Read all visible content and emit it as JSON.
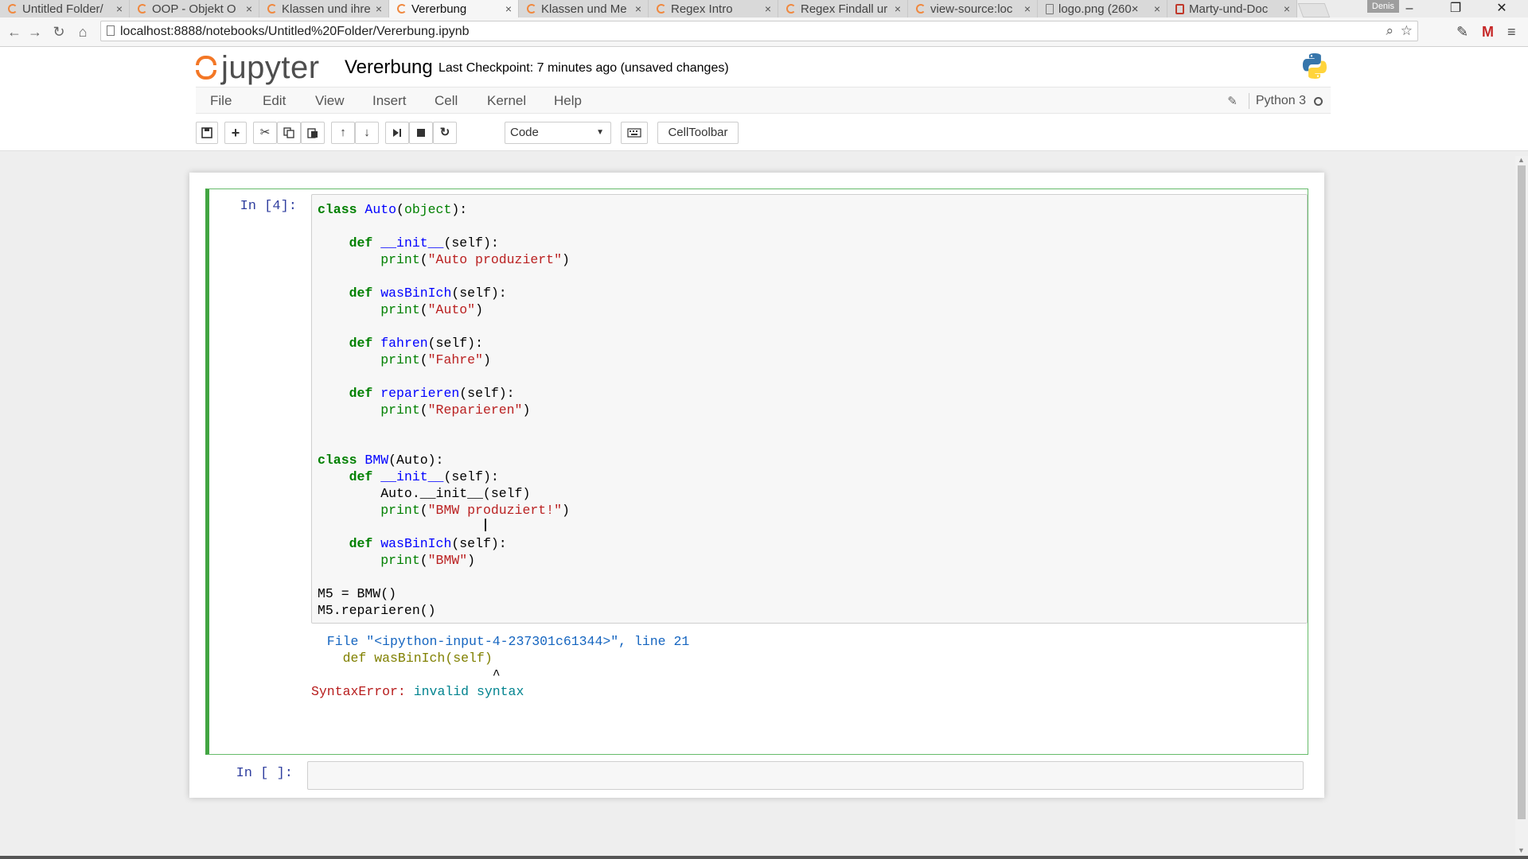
{
  "tabs": [
    {
      "label": "Untitled Folder/",
      "icon": "jupyter-icon",
      "active": false
    },
    {
      "label": "OOP - Objekt O",
      "icon": "jupyter-icon",
      "active": false
    },
    {
      "label": "Klassen und ihre",
      "icon": "jupyter-icon",
      "active": false
    },
    {
      "label": "Vererbung",
      "icon": "jupyter-icon",
      "active": true
    },
    {
      "label": "Klassen und Me",
      "icon": "jupyter-icon",
      "active": false
    },
    {
      "label": "Regex Intro",
      "icon": "jupyter-icon",
      "active": false
    },
    {
      "label": "Regex Findall ur",
      "icon": "jupyter-icon",
      "active": false
    },
    {
      "label": "view-source:loc",
      "icon": "jupyter-icon",
      "active": false
    },
    {
      "label": "logo.png (260×",
      "icon": "file-icon",
      "active": false
    },
    {
      "label": "Marty-und-Doc",
      "icon": "pdf-icon",
      "active": false
    }
  ],
  "tab_close": "×",
  "profile_name": "Denis",
  "window_controls": {
    "minimize": "–",
    "restore": "❐",
    "close": "✕"
  },
  "address": {
    "url": "localhost:8888/notebooks/Untitled%20Folder/Vererbung.ipynb"
  },
  "jupyter": {
    "brand": "jupyter",
    "notebook_title": "Vererbung",
    "checkpoint": "Last Checkpoint: 7 minutes ago (unsaved changes)",
    "kernel_name": "Python 3"
  },
  "menu": [
    "File",
    "Edit",
    "View",
    "Insert",
    "Cell",
    "Kernel",
    "Help"
  ],
  "toolbar": {
    "cell_type": "Code",
    "celltoolbar_label": "CellToolbar"
  },
  "cells": [
    {
      "prompt": "In [4]:",
      "code_lines": [
        "class Auto(object):",
        "",
        "    def __init__(self):",
        "        print(\"Auto produziert\")",
        "",
        "    def wasBinIch(self):",
        "        print(\"Auto\")",
        "",
        "    def fahren(self):",
        "        print(\"Fahre\")",
        "",
        "    def reparieren(self):",
        "        print(\"Reparieren\")",
        "",
        "",
        "class BMW(Auto):",
        "    def __init__(self):",
        "        Auto.__init__(self)",
        "        print(\"BMW produziert!\")",
        "",
        "    def wasBinIch(self):",
        "        print(\"BMW\")",
        "",
        "M5 = BMW()",
        "M5.reparieren()"
      ],
      "output": {
        "file_line": "  File \"<ipython-input-4-237301c61344>\", line 21",
        "source_line": "    def wasBinIch(self)",
        "caret_line": "                       ^",
        "error_name": "SyntaxError:",
        "error_message": "invalid syntax"
      }
    },
    {
      "prompt": "In [ ]:",
      "code_lines": []
    }
  ],
  "colors": {
    "selected_cell_border": "#42a542",
    "prompt_in": "#303f9f",
    "keyword": "#008000",
    "function_name": "#0000ff",
    "string": "#ba2121",
    "jupyter_orange": "#f37726"
  }
}
